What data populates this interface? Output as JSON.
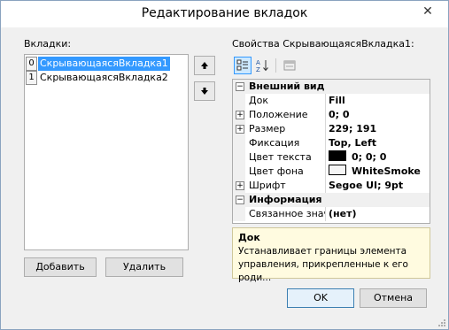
{
  "window": {
    "title": "Редактирование вкладок",
    "close_glyph": "✕"
  },
  "tabs_label": "Вкладки:",
  "tabs": [
    {
      "index": "0",
      "name": "СкрывающаясяВкладка1",
      "selected": true
    },
    {
      "index": "1",
      "name": "СкрывающаясяВкладка2",
      "selected": false
    }
  ],
  "move_up_icon": "arrow-up-icon",
  "move_down_icon": "arrow-down-icon",
  "add_label": "Добавить",
  "delete_label": "Удалить",
  "properties_label": "Свойства СкрывающаясяВкладка1:",
  "toolbar": {
    "categorized_icon": "categorized-icon",
    "alphabetical_icon": "alphabetical-icon",
    "property_pages_icon": "property-pages-icon"
  },
  "categories": {
    "appearance": "Внешний вид",
    "info": "Информация"
  },
  "props": {
    "dock": {
      "name": "Док",
      "value": "Fill"
    },
    "location": {
      "name": "Положение",
      "value": "0; 0"
    },
    "size": {
      "name": "Размер",
      "value": "229; 191"
    },
    "anchor": {
      "name": "Фиксация",
      "value": "Top, Left"
    },
    "forecolor": {
      "name": "Цвет текста",
      "value": "0; 0; 0",
      "color": "#000000"
    },
    "backcolor": {
      "name": "Цвет фона",
      "value": "WhiteSmoke",
      "color": "#f5f5f5"
    },
    "font": {
      "name": "Шрифт",
      "value": "Segoe UI; 9pt"
    },
    "linked": {
      "name": "Связанное знач",
      "value": "(нет)"
    }
  },
  "help": {
    "title": "Док",
    "text": "Устанавливает границы элемента управления, прикрепленные к его роди..."
  },
  "ok_label": "OK",
  "cancel_label": "Отмена"
}
